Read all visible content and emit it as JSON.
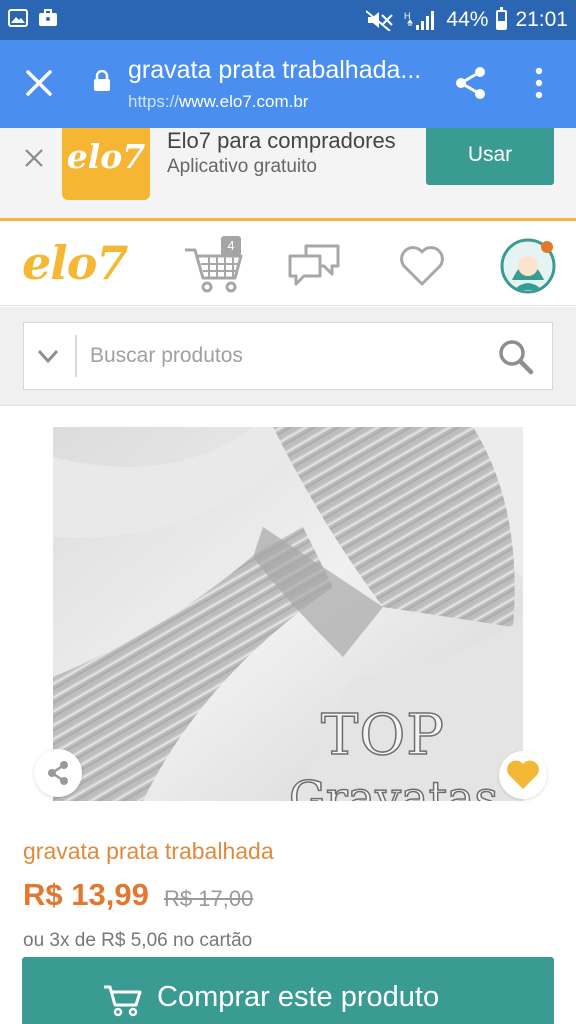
{
  "status_bar": {
    "battery": "44%",
    "time": "21:01",
    "icons": [
      "gallery-icon",
      "briefcase-icon",
      "mute-icon",
      "signal-icon",
      "battery-icon"
    ]
  },
  "browser": {
    "page_title": "gravata prata trabalhada...",
    "url_scheme": "https://",
    "url_host": "www.elo7.com.br",
    "icons": [
      "close-icon",
      "lock-icon",
      "share-icon",
      "more-vert-icon"
    ]
  },
  "app_banner": {
    "logo_text": "elo7",
    "title": "Elo7 para compradores",
    "subtitle": "Aplicativo gratuito",
    "button_label": "Usar",
    "accent": "#f6b634"
  },
  "site_header": {
    "logo_text": "elo7",
    "cart_count": "4",
    "icons": [
      "cart-icon",
      "chat-icon",
      "heart-icon",
      "avatar-icon"
    ]
  },
  "search": {
    "placeholder": "Buscar produtos"
  },
  "product": {
    "image_watermark_line1": "TOP",
    "image_watermark_line2": "Gravatas",
    "title": "gravata prata trabalhada",
    "price": "R$ 13,99",
    "old_price": "R$ 17,00",
    "installments": "ou 3x de R$ 5,06 no cartão",
    "buy_label": "Comprar este produto"
  },
  "colors": {
    "status_bar": "#2b66b3",
    "toolbar": "#4a8ef0",
    "teal": "#3a9b93",
    "orange": "#e2772e",
    "logo_yellow": "#f5b834"
  }
}
